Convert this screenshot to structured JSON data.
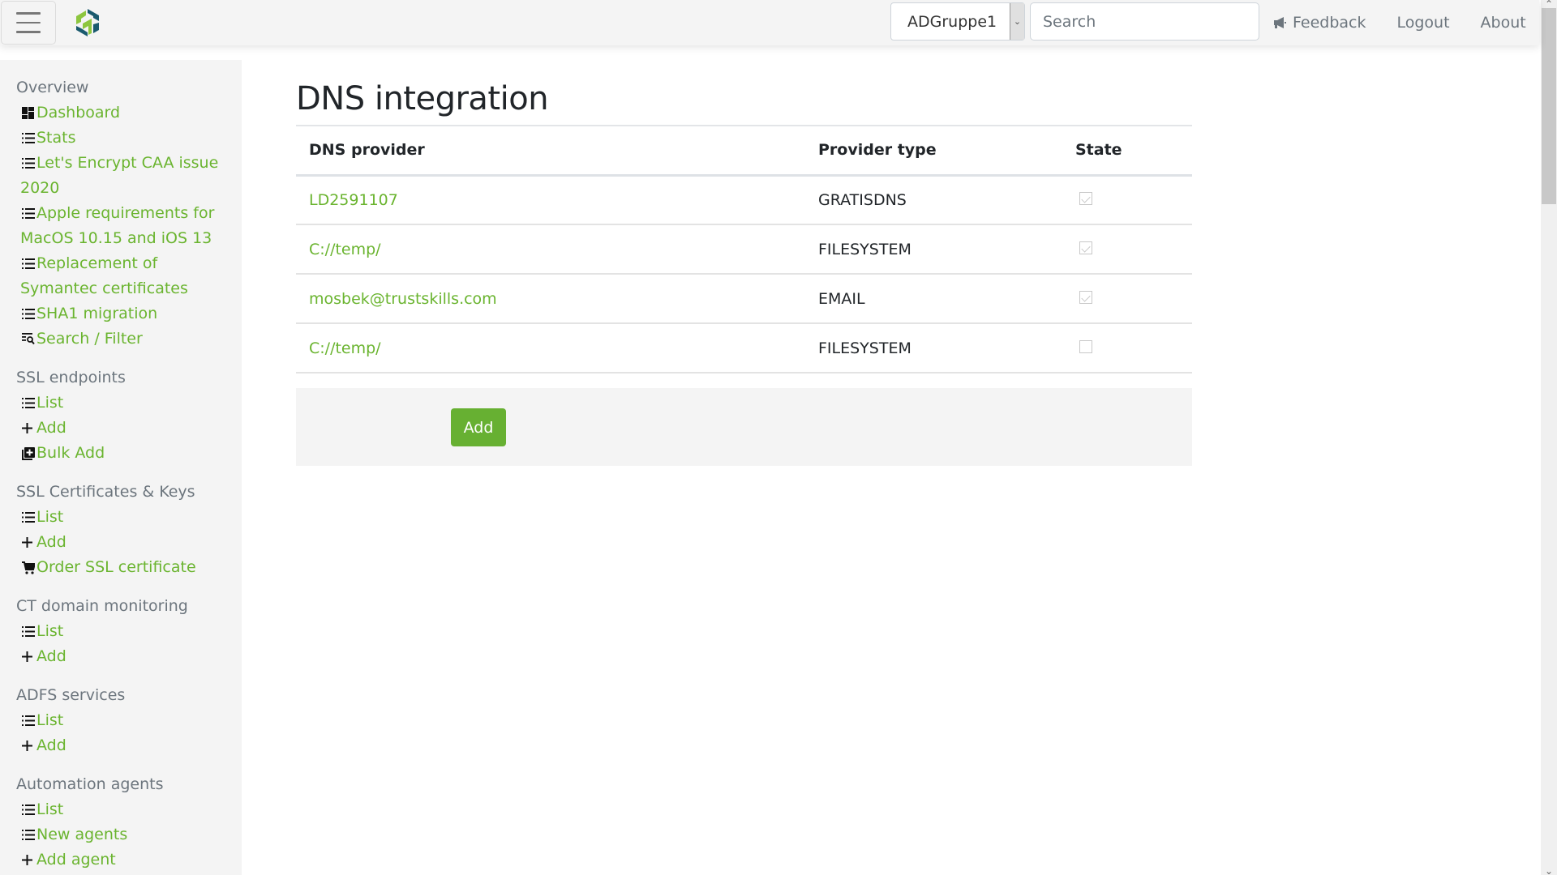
{
  "header": {
    "menu_icon": "hamburger-icon",
    "logo_icon": "app-logo",
    "group_selector": {
      "value": "ADGruppe1"
    },
    "search": {
      "placeholder": "Search",
      "value": ""
    },
    "links": [
      {
        "label": "Feedback",
        "icon": "megaphone-icon"
      },
      {
        "label": "Logout"
      },
      {
        "label": "About"
      }
    ]
  },
  "sidebar": {
    "sections": [
      {
        "title": "Overview",
        "items": [
          {
            "label": "Dashboard",
            "icon": "dashboard-icon"
          },
          {
            "label": "Stats",
            "icon": "list-icon"
          },
          {
            "label": "Let's Encrypt CAA issue",
            "label2": "2020",
            "icon": "list-icon"
          },
          {
            "label": "Apple requirements for",
            "label2": "MacOS 10.15 and iOS 13",
            "icon": "list-icon"
          },
          {
            "label": "Replacement of",
            "label2": "Symantec certificates",
            "icon": "list-icon"
          },
          {
            "label": "SHA1 migration",
            "icon": "list-icon"
          },
          {
            "label": "Search / Filter",
            "icon": "search-filter-icon"
          }
        ]
      },
      {
        "title": "SSL endpoints",
        "items": [
          {
            "label": "List",
            "icon": "list-icon"
          },
          {
            "label": "Add",
            "icon": "plus-icon"
          },
          {
            "label": "Bulk Add",
            "icon": "bulk-add-icon"
          }
        ]
      },
      {
        "title": "SSL Certificates & Keys",
        "items": [
          {
            "label": "List",
            "icon": "list-icon"
          },
          {
            "label": "Add",
            "icon": "plus-icon"
          },
          {
            "label": "Order SSL certificate",
            "icon": "cart-icon"
          }
        ]
      },
      {
        "title": "CT domain monitoring",
        "items": [
          {
            "label": "List",
            "icon": "list-icon"
          },
          {
            "label": "Add",
            "icon": "plus-icon"
          }
        ]
      },
      {
        "title": "ADFS services",
        "items": [
          {
            "label": "List",
            "icon": "list-icon"
          },
          {
            "label": "Add",
            "icon": "plus-icon"
          }
        ]
      },
      {
        "title": "Automation agents",
        "items": [
          {
            "label": "List",
            "icon": "list-icon"
          },
          {
            "label": "New agents",
            "icon": "list-icon"
          },
          {
            "label": "Add agent",
            "icon": "plus-icon"
          }
        ]
      }
    ]
  },
  "main": {
    "title": "DNS integration",
    "table": {
      "columns": [
        "DNS provider",
        "Provider type",
        "State"
      ],
      "rows": [
        {
          "provider": "LD2591107",
          "type": "GRATISDNS",
          "state": true
        },
        {
          "provider": "C://temp/",
          "type": "FILESYSTEM",
          "state": true
        },
        {
          "provider": "mosbek@trustskills.com",
          "type": "EMAIL",
          "state": true
        },
        {
          "provider": "C://temp/",
          "type": "FILESYSTEM",
          "state": false
        }
      ]
    },
    "add_button": "Add"
  },
  "colors": {
    "accent": "#6ab42f",
    "button": "#67b032",
    "sidebar_bg": "#f4f4f4",
    "muted_text": "#6c757d"
  }
}
